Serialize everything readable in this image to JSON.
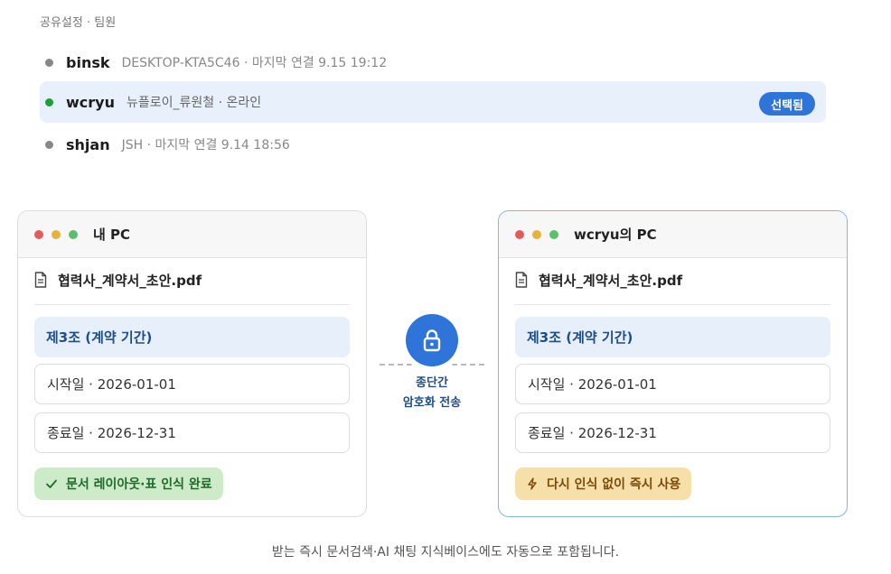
{
  "section_label": "공유설정 · 팀원",
  "members": [
    {
      "name": "binsk",
      "detail": "DESKTOP-KTA5C46 · 마지막 연결 9.15 19:12",
      "selected": false
    },
    {
      "name": "wcryu",
      "detail": "뉴플로이_류원철 · 온라인",
      "selected": true,
      "badge": "선택됨"
    },
    {
      "name": "shjan",
      "detail": "JSH · 마지막 연결 9.14 18:56",
      "selected": false
    }
  ],
  "local_pc": {
    "title": "내 PC",
    "file_name": "협력사_계약서_초안.pdf",
    "section_heading": "제3조 (계약 기간)",
    "field_start": "시작일 · 2026-01-01",
    "field_end": "종료일 · 2026-12-31",
    "status": "문서 레이아웃·표 인식 완료"
  },
  "remote_pc": {
    "title": "wcryu의 PC",
    "file_name": "협력사_계약서_초안.pdf",
    "section_heading": "제3조 (계약 기간)",
    "field_start": "시작일 · 2026-01-01",
    "field_end": "종료일 · 2026-12-31",
    "status": "다시 인식 없이 즉시 사용"
  },
  "transfer": {
    "label_line1": "종단간",
    "label_line2": "암호화 전송"
  },
  "footer": "받는 즉시 문서검색·AI 채팅 지식베이스에도 자동으로 포함됩니다.",
  "colors": {
    "accent": "#2f74d8",
    "online": "#1aa033",
    "offline": "#888888",
    "success_bg": "#cdebc9",
    "warn_bg": "#f7dfaa"
  }
}
